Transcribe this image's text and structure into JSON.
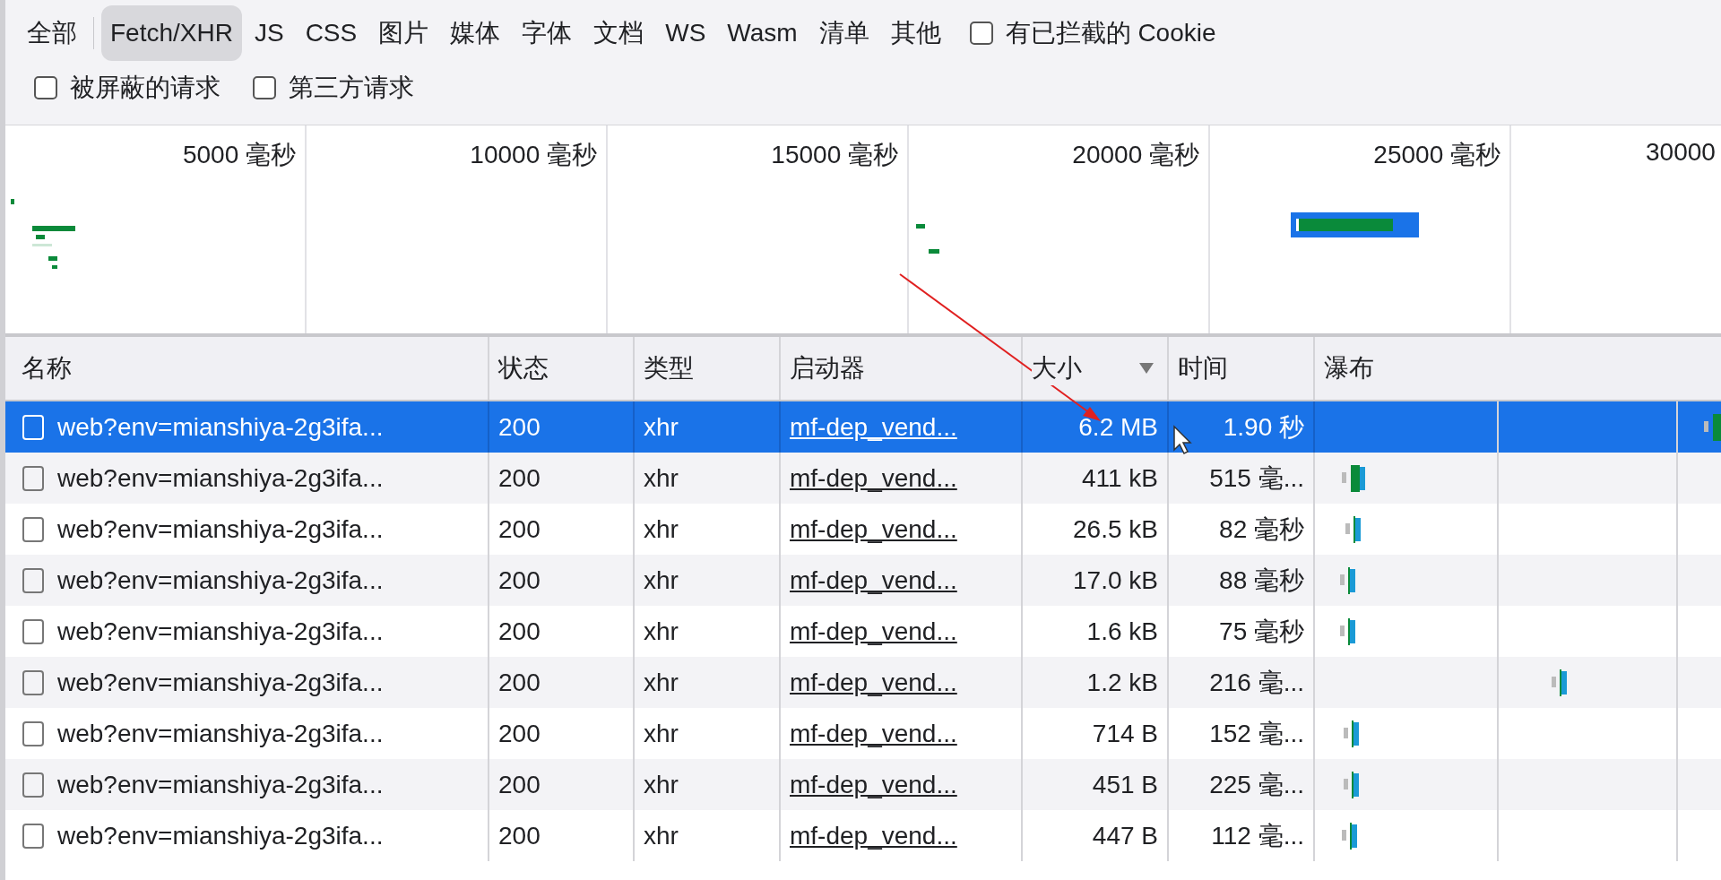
{
  "filters": [
    {
      "label": "全部",
      "selected": false
    },
    {
      "label": "Fetch/XHR",
      "selected": true
    },
    {
      "label": "JS",
      "selected": false
    },
    {
      "label": "CSS",
      "selected": false
    },
    {
      "label": "图片",
      "selected": false
    },
    {
      "label": "媒体",
      "selected": false
    },
    {
      "label": "字体",
      "selected": false
    },
    {
      "label": "文档",
      "selected": false
    },
    {
      "label": "WS",
      "selected": false
    },
    {
      "label": "Wasm",
      "selected": false
    },
    {
      "label": "清单",
      "selected": false
    },
    {
      "label": "其他",
      "selected": false
    }
  ],
  "options": [
    {
      "label": "有已拦截的 Cookie",
      "checked": false
    },
    {
      "label": "被屏蔽的请求",
      "checked": false
    },
    {
      "label": "第三方请求",
      "checked": false
    }
  ],
  "overview": {
    "ticks": [
      "5000 毫秒",
      "10000 毫秒",
      "15000 毫秒",
      "20000 毫秒",
      "25000 毫秒",
      "30000"
    ]
  },
  "table": {
    "columns": [
      {
        "label": "名称",
        "sorted": false
      },
      {
        "label": "状态",
        "sorted": false
      },
      {
        "label": "类型",
        "sorted": false
      },
      {
        "label": "启动器",
        "sorted": false
      },
      {
        "label": "大小",
        "sorted": true
      },
      {
        "label": "时间",
        "sorted": false
      },
      {
        "label": "瀑布",
        "sorted": false
      }
    ],
    "rows": [
      {
        "name": "web?env=mianshiya-2g3ifa...",
        "status": "200",
        "type": "xhr",
        "initiator": "mf-dep_vend...",
        "size": "6.2 MB",
        "time": "1.90 秒",
        "selected": true
      },
      {
        "name": "web?env=mianshiya-2g3ifa...",
        "status": "200",
        "type": "xhr",
        "initiator": "mf-dep_vend...",
        "size": "411 kB",
        "time": "515 毫...",
        "selected": false
      },
      {
        "name": "web?env=mianshiya-2g3ifa...",
        "status": "200",
        "type": "xhr",
        "initiator": "mf-dep_vend...",
        "size": "26.5 kB",
        "time": "82 毫秒",
        "selected": false
      },
      {
        "name": "web?env=mianshiya-2g3ifa...",
        "status": "200",
        "type": "xhr",
        "initiator": "mf-dep_vend...",
        "size": "17.0 kB",
        "time": "88 毫秒",
        "selected": false
      },
      {
        "name": "web?env=mianshiya-2g3ifa...",
        "status": "200",
        "type": "xhr",
        "initiator": "mf-dep_vend...",
        "size": "1.6 kB",
        "time": "75 毫秒",
        "selected": false
      },
      {
        "name": "web?env=mianshiya-2g3ifa...",
        "status": "200",
        "type": "xhr",
        "initiator": "mf-dep_vend...",
        "size": "1.2 kB",
        "time": "216 毫...",
        "selected": false
      },
      {
        "name": "web?env=mianshiya-2g3ifa...",
        "status": "200",
        "type": "xhr",
        "initiator": "mf-dep_vend...",
        "size": "714 B",
        "time": "152 毫...",
        "selected": false
      },
      {
        "name": "web?env=mianshiya-2g3ifa...",
        "status": "200",
        "type": "xhr",
        "initiator": "mf-dep_vend...",
        "size": "451 B",
        "time": "225 毫...",
        "selected": false
      },
      {
        "name": "web?env=mianshiya-2g3ifa...",
        "status": "200",
        "type": "xhr",
        "initiator": "mf-dep_vend...",
        "size": "447 B",
        "time": "112 毫...",
        "selected": false
      }
    ]
  }
}
